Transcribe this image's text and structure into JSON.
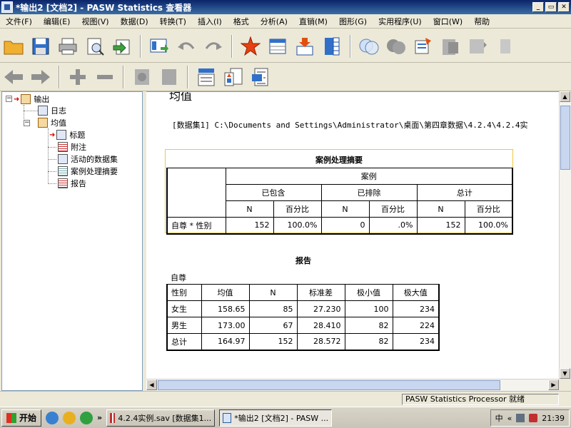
{
  "window": {
    "title": "*输出2 [文档2] - PASW Statistics 查看器",
    "controls": [
      "_",
      "▭",
      "✕"
    ]
  },
  "menu": [
    "文件(F)",
    "编辑(E)",
    "视图(V)",
    "数据(D)",
    "转换(T)",
    "插入(I)",
    "格式",
    "分析(A)",
    "直销(M)",
    "图形(G)",
    "实用程序(U)",
    "窗口(W)",
    "帮助"
  ],
  "tree": {
    "root": "输出",
    "log": "日志",
    "means": "均值",
    "children": [
      "标题",
      "附注",
      "活动的数据集",
      "案例处理摘要",
      "报告"
    ]
  },
  "output": {
    "heading": "均值",
    "dataset_line": "[数据集1] C:\\Documents and Settings\\Administrator\\桌面\\第四章数据\\4.2.4\\4.2.4实",
    "case_summary": {
      "title": "案例处理摘要",
      "group_header": "案例",
      "sub_headers": [
        "已包含",
        "已排除",
        "总计"
      ],
      "col_headers": [
        "N",
        "百分比",
        "N",
        "百分比",
        "N",
        "百分比"
      ],
      "row_label": "自尊 * 性别",
      "row_values": [
        "152",
        "100.0%",
        "0",
        ".0%",
        "152",
        "100.0%"
      ]
    },
    "report": {
      "title": "报告",
      "variable": "自尊",
      "headers": [
        "性别",
        "均值",
        "N",
        "标准差",
        "极小值",
        "极大值"
      ],
      "rows": [
        [
          "女生",
          "158.65",
          "85",
          "27.230",
          "100",
          "234"
        ],
        [
          "男生",
          "173.00",
          "67",
          "28.410",
          "82",
          "224"
        ],
        [
          "总计",
          "164.97",
          "152",
          "28.572",
          "82",
          "234"
        ]
      ]
    }
  },
  "status": "PASW Statistics Processor 就绪",
  "taskbar": {
    "start": "开始",
    "tasks": [
      "4.2.4实例.sav [数据集1...",
      "*输出2 [文档2] - PASW ..."
    ],
    "tray_text": "中",
    "clock": "21:39"
  }
}
